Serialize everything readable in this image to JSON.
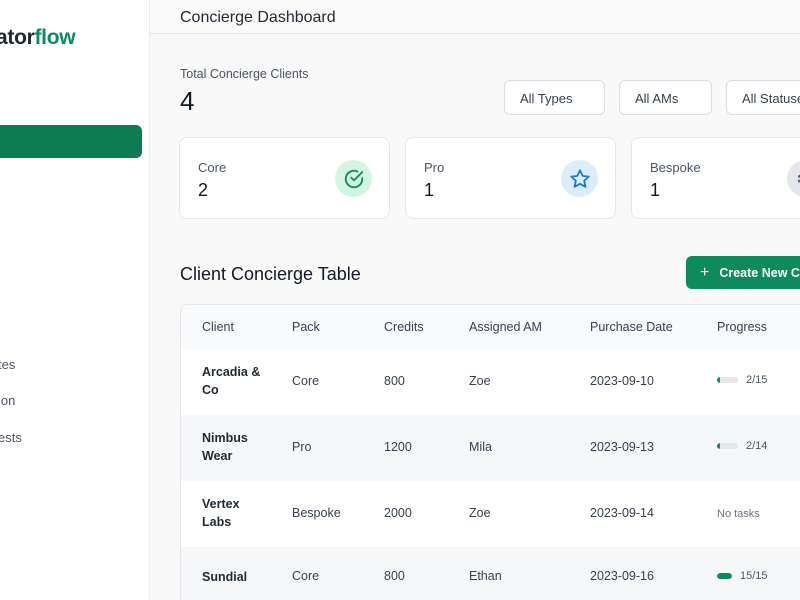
{
  "brand": {
    "name_start": "ator",
    "name_accent": "flow",
    "accent_color": "#0f8a5f"
  },
  "sidebar": {
    "items": [
      {
        "label": "tes"
      },
      {
        "label": "ion"
      },
      {
        "label": "ests"
      }
    ]
  },
  "header": {
    "title": "Concierge Dashboard"
  },
  "summary": {
    "label": "Total Concierge Clients",
    "value": "4"
  },
  "filters": [
    {
      "label": "All Types"
    },
    {
      "label": "All AMs"
    },
    {
      "label": "All Statuses"
    }
  ],
  "stats": [
    {
      "label": "Core",
      "value": "2",
      "icon": "check-circle-icon"
    },
    {
      "label": "Pro",
      "value": "1",
      "icon": "star-icon"
    },
    {
      "label": "Bespoke",
      "value": "1",
      "icon": "gear-icon"
    }
  ],
  "table": {
    "title": "Client Concierge Table",
    "create_label": "Create New C",
    "columns": [
      "Client",
      "Pack",
      "Credits",
      "Assigned AM",
      "Purchase Date",
      "Progress"
    ],
    "rows": [
      {
        "client": "Arcadia & Co",
        "pack": "Core",
        "credits": "800",
        "am": "Zoe",
        "date": "2023-09-10",
        "progress_text": "2/15",
        "progress": 0.133
      },
      {
        "client": "Nimbus Wear",
        "pack": "Pro",
        "credits": "1200",
        "am": "Mila",
        "date": "2023-09-13",
        "progress_text": "2/14",
        "progress": 0.143
      },
      {
        "client": "Vertex Labs",
        "pack": "Bespoke",
        "credits": "2000",
        "am": "Zoe",
        "date": "2023-09-14",
        "progress_text": "No tasks",
        "progress": null
      },
      {
        "client": "Sundial",
        "pack": "Core",
        "credits": "800",
        "am": "Ethan",
        "date": "2023-09-16",
        "progress_text": "15/15",
        "progress": 1.0
      }
    ]
  }
}
